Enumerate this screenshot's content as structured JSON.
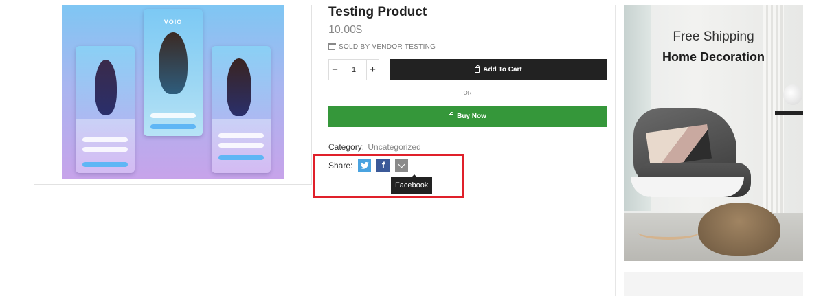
{
  "product": {
    "title": "Testing Product",
    "price": "10.00$",
    "vendor": "SOLD BY VENDOR TESTING",
    "quantity": "1",
    "add_to_cart_label": "Add To Cart",
    "or_label": "OR",
    "buy_now_label": "Buy Now",
    "category_label": "Category:",
    "category_value": "Uncategorized",
    "share_label": "Share:",
    "tooltip": "Facebook",
    "gallery_brand": "VOIO"
  },
  "share_icons": [
    "twitter-icon",
    "facebook-icon",
    "email-icon"
  ],
  "banner": {
    "subtitle": "Free Shipping",
    "title": "Home Decoration"
  },
  "colors": {
    "add_to_cart_bg": "#222222",
    "buy_now_bg": "#35973a",
    "highlight_border": "#e0202a",
    "twitter": "#4aa3e0",
    "facebook": "#3b5998",
    "email": "#8a8a8a"
  }
}
